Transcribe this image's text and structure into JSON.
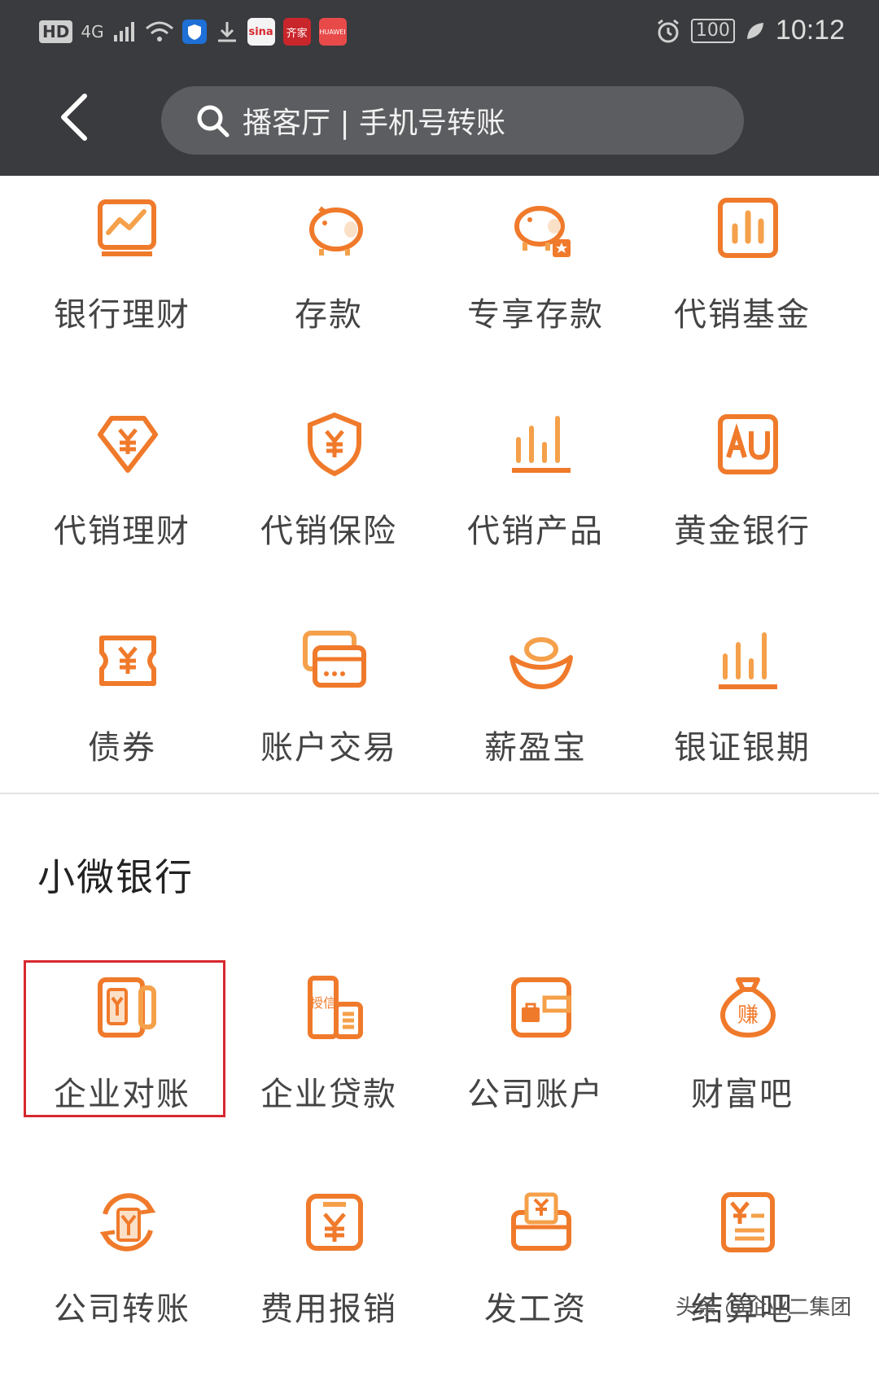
{
  "status_bar": {
    "left": [
      "HD",
      "4G",
      "sina",
      "齐家",
      "HUAWEI"
    ],
    "battery": "100",
    "time": "10:12"
  },
  "search": {
    "placeholder": "播客厅 | 手机号转账"
  },
  "products": [
    {
      "label": "银行理财",
      "icon": "chart-line-icon"
    },
    {
      "label": "存款",
      "icon": "piggy-bank-icon"
    },
    {
      "label": "专享存款",
      "icon": "piggy-bank-star-icon"
    },
    {
      "label": "代销基金",
      "icon": "bar-chart-icon"
    },
    {
      "label": "代销理财",
      "icon": "yen-diamond-icon"
    },
    {
      "label": "代销保险",
      "icon": "yen-shield-icon"
    },
    {
      "label": "代销产品",
      "icon": "bar-chart-icon"
    },
    {
      "label": "黄金银行",
      "icon": "au-icon"
    },
    {
      "label": "债券",
      "icon": "yen-ticket-icon"
    },
    {
      "label": "账户交易",
      "icon": "cards-icon"
    },
    {
      "label": "薪盈宝",
      "icon": "gold-ingot-icon"
    },
    {
      "label": "银证银期",
      "icon": "bar-chart-icon"
    }
  ],
  "section": {
    "title": "小微银行"
  },
  "sme": [
    {
      "label": "企业对账",
      "icon": "reconcile-icon"
    },
    {
      "label": "企业贷款",
      "icon": "credit-building-icon",
      "badge": "授信"
    },
    {
      "label": "公司账户",
      "icon": "wallet-icon"
    },
    {
      "label": "财富吧",
      "icon": "money-bag-icon",
      "badge": "赚"
    },
    {
      "label": "公司转账",
      "icon": "transfer-icon"
    },
    {
      "label": "费用报销",
      "icon": "yen-box-icon"
    },
    {
      "label": "发工资",
      "icon": "salary-icon"
    },
    {
      "label": "结算吧",
      "icon": "yen-document-icon"
    }
  ],
  "watermark": "头条 @企业二集团",
  "colors": {
    "accent": "#f07a2b",
    "header": "#3a3b3e",
    "highlight": "#d7282f"
  }
}
